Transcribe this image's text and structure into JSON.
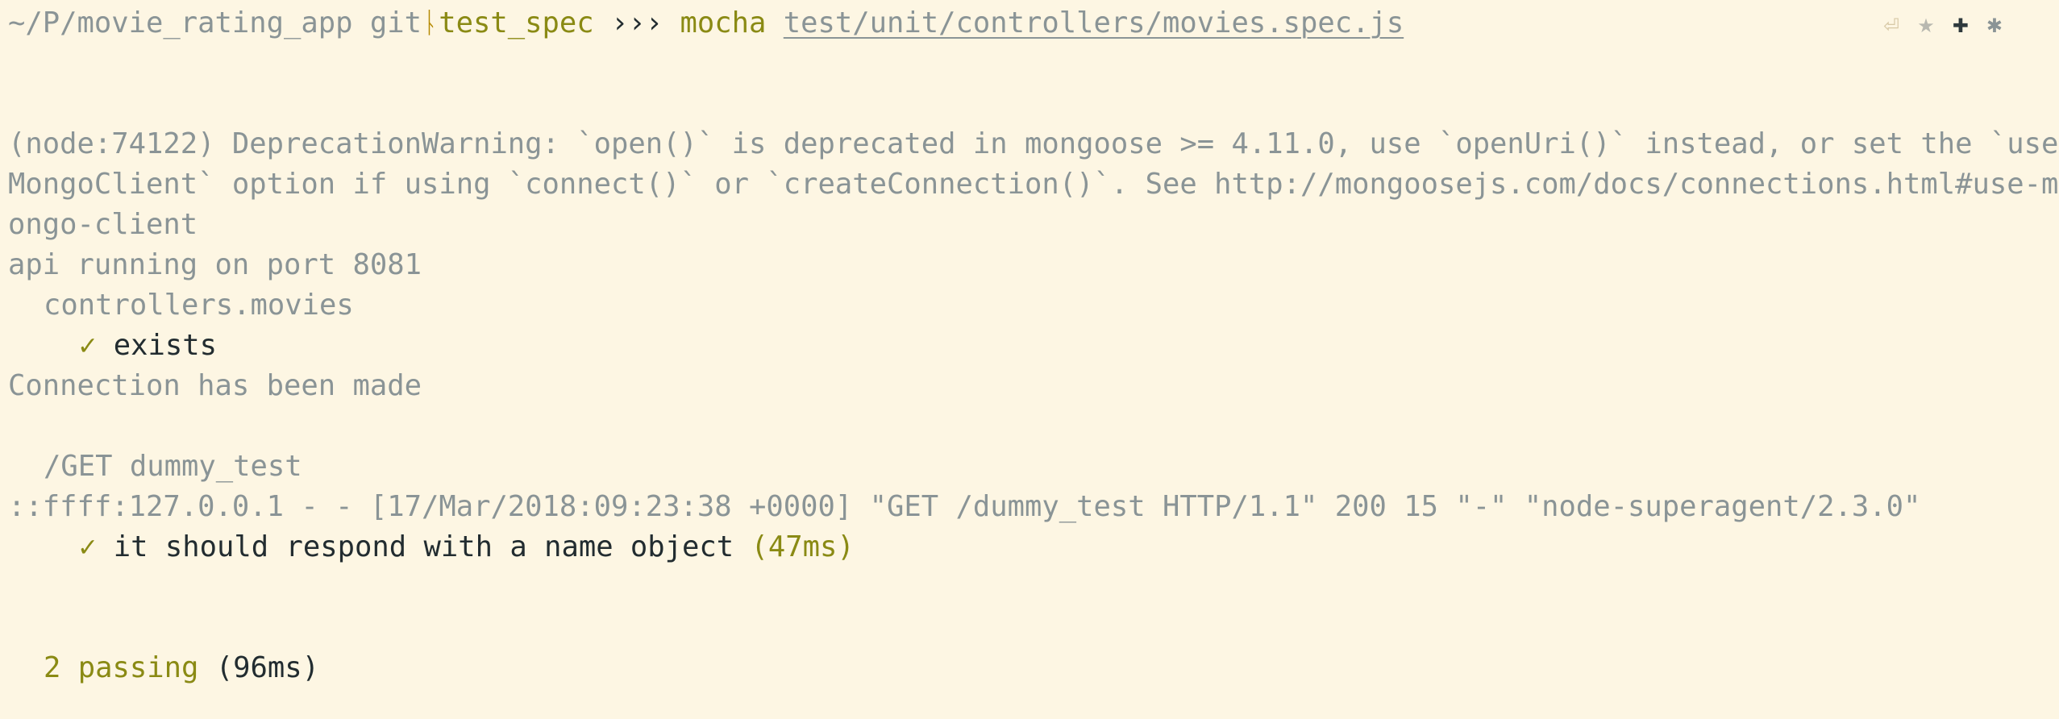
{
  "prompt": {
    "path": "~/P/movie_rating_app",
    "git_label": "git",
    "git_separator": "ᚿ",
    "branch": "test_spec",
    "arrows": "›››",
    "command": "mocha",
    "argument": "test/unit/controllers/movies.spec.js"
  },
  "status_icons": {
    "return": "⏎",
    "star": "★",
    "plus": "✚",
    "gear": "✱"
  },
  "output": {
    "deprecation_warning": "(node:74122) DeprecationWarning: `open()` is deprecated in mongoose >= 4.11.0, use `openUri()` instead, or set the `useMongoClient` option if using `connect()` or `createConnection()`. See http://mongoosejs.com/docs/connections.html#use-mongo-client",
    "api_running": "api running on port 8081",
    "suite_movies": "controllers.movies",
    "check_mark_1": "✓",
    "test_exists": "exists",
    "connection_made": "Connection has been made",
    "suite_get": "/GET dummy_test",
    "access_log": "::ffff:127.0.0.1 - - [17/Mar/2018:09:23:38 +0000] \"GET /dummy_test HTTP/1.1\" 200 15 \"-\" \"node-superagent/2.3.0\"",
    "check_mark_2": "✓",
    "test_respond": "it should respond with a name object",
    "test_respond_time": "(47ms)",
    "passing_count": "2 passing",
    "passing_time": "(96ms)"
  }
}
